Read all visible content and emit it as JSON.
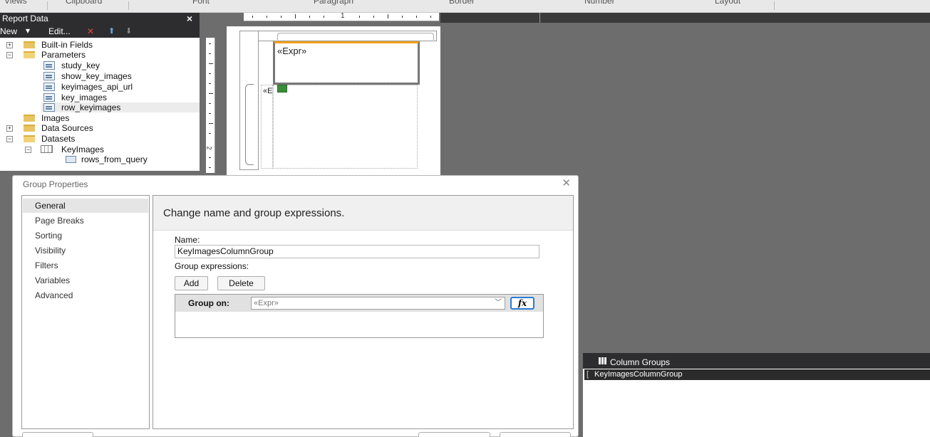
{
  "ribbon": {
    "groups": [
      "Views",
      "Clipboard",
      "Font",
      "Paragraph",
      "Border",
      "Number",
      "Layout"
    ]
  },
  "report_data": {
    "title": "Report Data",
    "close_glyph": "×",
    "toolbar": {
      "new_label": "New",
      "edit_label": "Edit...",
      "delete_glyph": "✕",
      "up_glyph": "⬆",
      "down_glyph": "⬇"
    },
    "tree": {
      "built_in_fields": "Built-in Fields",
      "parameters": "Parameters",
      "params": [
        "study_key",
        "show_key_images",
        "keyimages_api_url",
        "key_images",
        "row_keyimages"
      ],
      "images": "Images",
      "data_sources": "Data Sources",
      "datasets": "Datasets",
      "dataset_name": "KeyImages",
      "dataset_field": "rows_from_query"
    }
  },
  "design": {
    "ruler_mark": "1",
    "ruler_left_mark": "2",
    "expr_text": "«Expr»",
    "side_text": "«E"
  },
  "dialog": {
    "title": "Group Properties",
    "close_glyph": "✕",
    "nav_items": [
      "General",
      "Page Breaks",
      "Sorting",
      "Visibility",
      "Filters",
      "Variables",
      "Advanced"
    ],
    "active_nav": "General",
    "heading": "Change name and group expressions.",
    "name_label": "Name:",
    "name_value": "KeyImagesColumnGroup",
    "group_expr_label": "Group expressions:",
    "add_label": "Add",
    "delete_label": "Delete",
    "group_on_label": "Group on:",
    "group_on_value": "«Expr»",
    "fx_label": "fx"
  },
  "column_groups": {
    "title": "Column Groups",
    "items": [
      "KeyImagesColumnGroup"
    ]
  }
}
